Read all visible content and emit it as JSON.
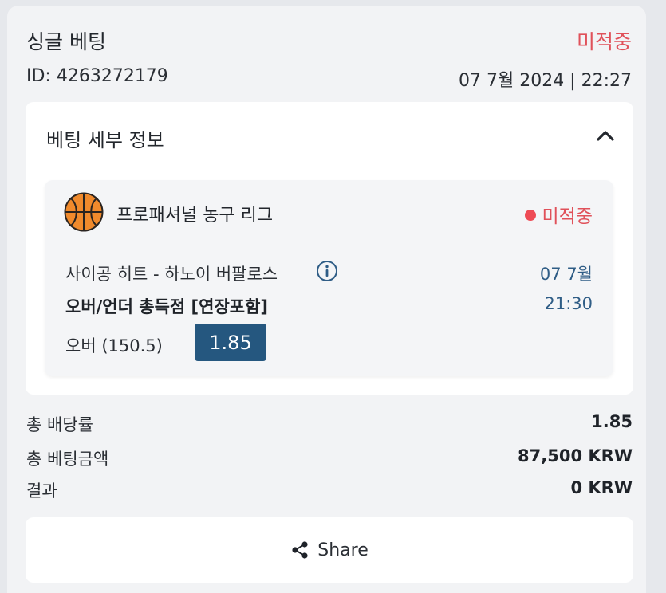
{
  "header": {
    "title": "싱글 베팅",
    "status": "미적중",
    "bet_id": "ID: 4263272179",
    "datetime": "07 7월 2024 | 22:27"
  },
  "details": {
    "title": "베팅 세부 정보",
    "collapse_icon": "chevron-up-icon",
    "event": {
      "sport_icon": "basketball-icon",
      "league": "프로패셔널 농구 리그",
      "status": "미적중",
      "match": "사이공 히트 - 하노이 버팔로스",
      "info_icon": "info-icon",
      "date": "07 7월",
      "market": "오버/언더 총득점 [연장포함]",
      "time": "21:30",
      "selection": "오버 (150.5)",
      "odds": "1.85"
    }
  },
  "summary": {
    "items": [
      {
        "label": "총 배당률",
        "value": "1.85"
      },
      {
        "label": "총 베팅금액",
        "value": "87,500 KRW"
      },
      {
        "label": "결과",
        "value": "0 KRW"
      }
    ]
  },
  "share": {
    "icon": "share-icon",
    "label": "Share"
  },
  "colors": {
    "loss": "#e0515a",
    "accent": "#25577f",
    "date_text": "#2f5d86"
  }
}
